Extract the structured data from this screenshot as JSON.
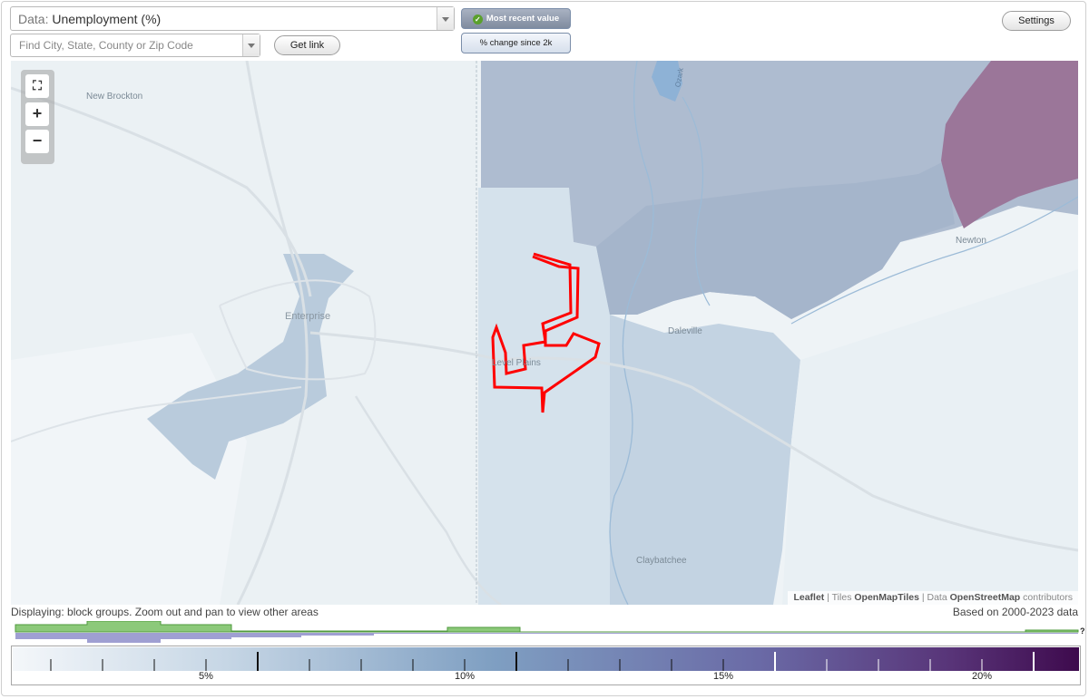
{
  "controls": {
    "data_label": "Data:",
    "data_value": "Unemployment (%)",
    "search_placeholder": "Find City, State, County or Zip Code",
    "get_link": "Get link",
    "settings": "Settings",
    "toggle_recent": "Most recent value",
    "toggle_change": "% change since 2k"
  },
  "map": {
    "places": [
      "New Brockton",
      "Enterprise",
      "Level Plains",
      "Daleville",
      "Newton",
      "Claybatchee"
    ],
    "road_label": "Ozark",
    "attribution": {
      "leaflet": "Leaflet",
      "tiles_prefix": "| Tiles",
      "tiles": "OpenMapTiles",
      "data_prefix": "| Data",
      "data": "OpenStreetMap",
      "suffix": "contributors"
    },
    "zoom_buttons": [
      "fullscreen",
      "+",
      "−"
    ],
    "highlight_color": "#ff0000"
  },
  "status": {
    "displaying": "Displaying: block groups. Zoom out and pan to view other areas",
    "based_on": "Based on 2000-2023 data",
    "help_mark": "?"
  },
  "legend": {
    "tick_labels": [
      "5%",
      "10%",
      "15%",
      "20%"
    ],
    "color_start": "#f4f7fa",
    "color_mid": "#7f9fc2",
    "color_end": "#3e0a4d"
  },
  "colors": {
    "green_hist": "#8cc97a",
    "purple_hist": "#9f9fd2"
  }
}
